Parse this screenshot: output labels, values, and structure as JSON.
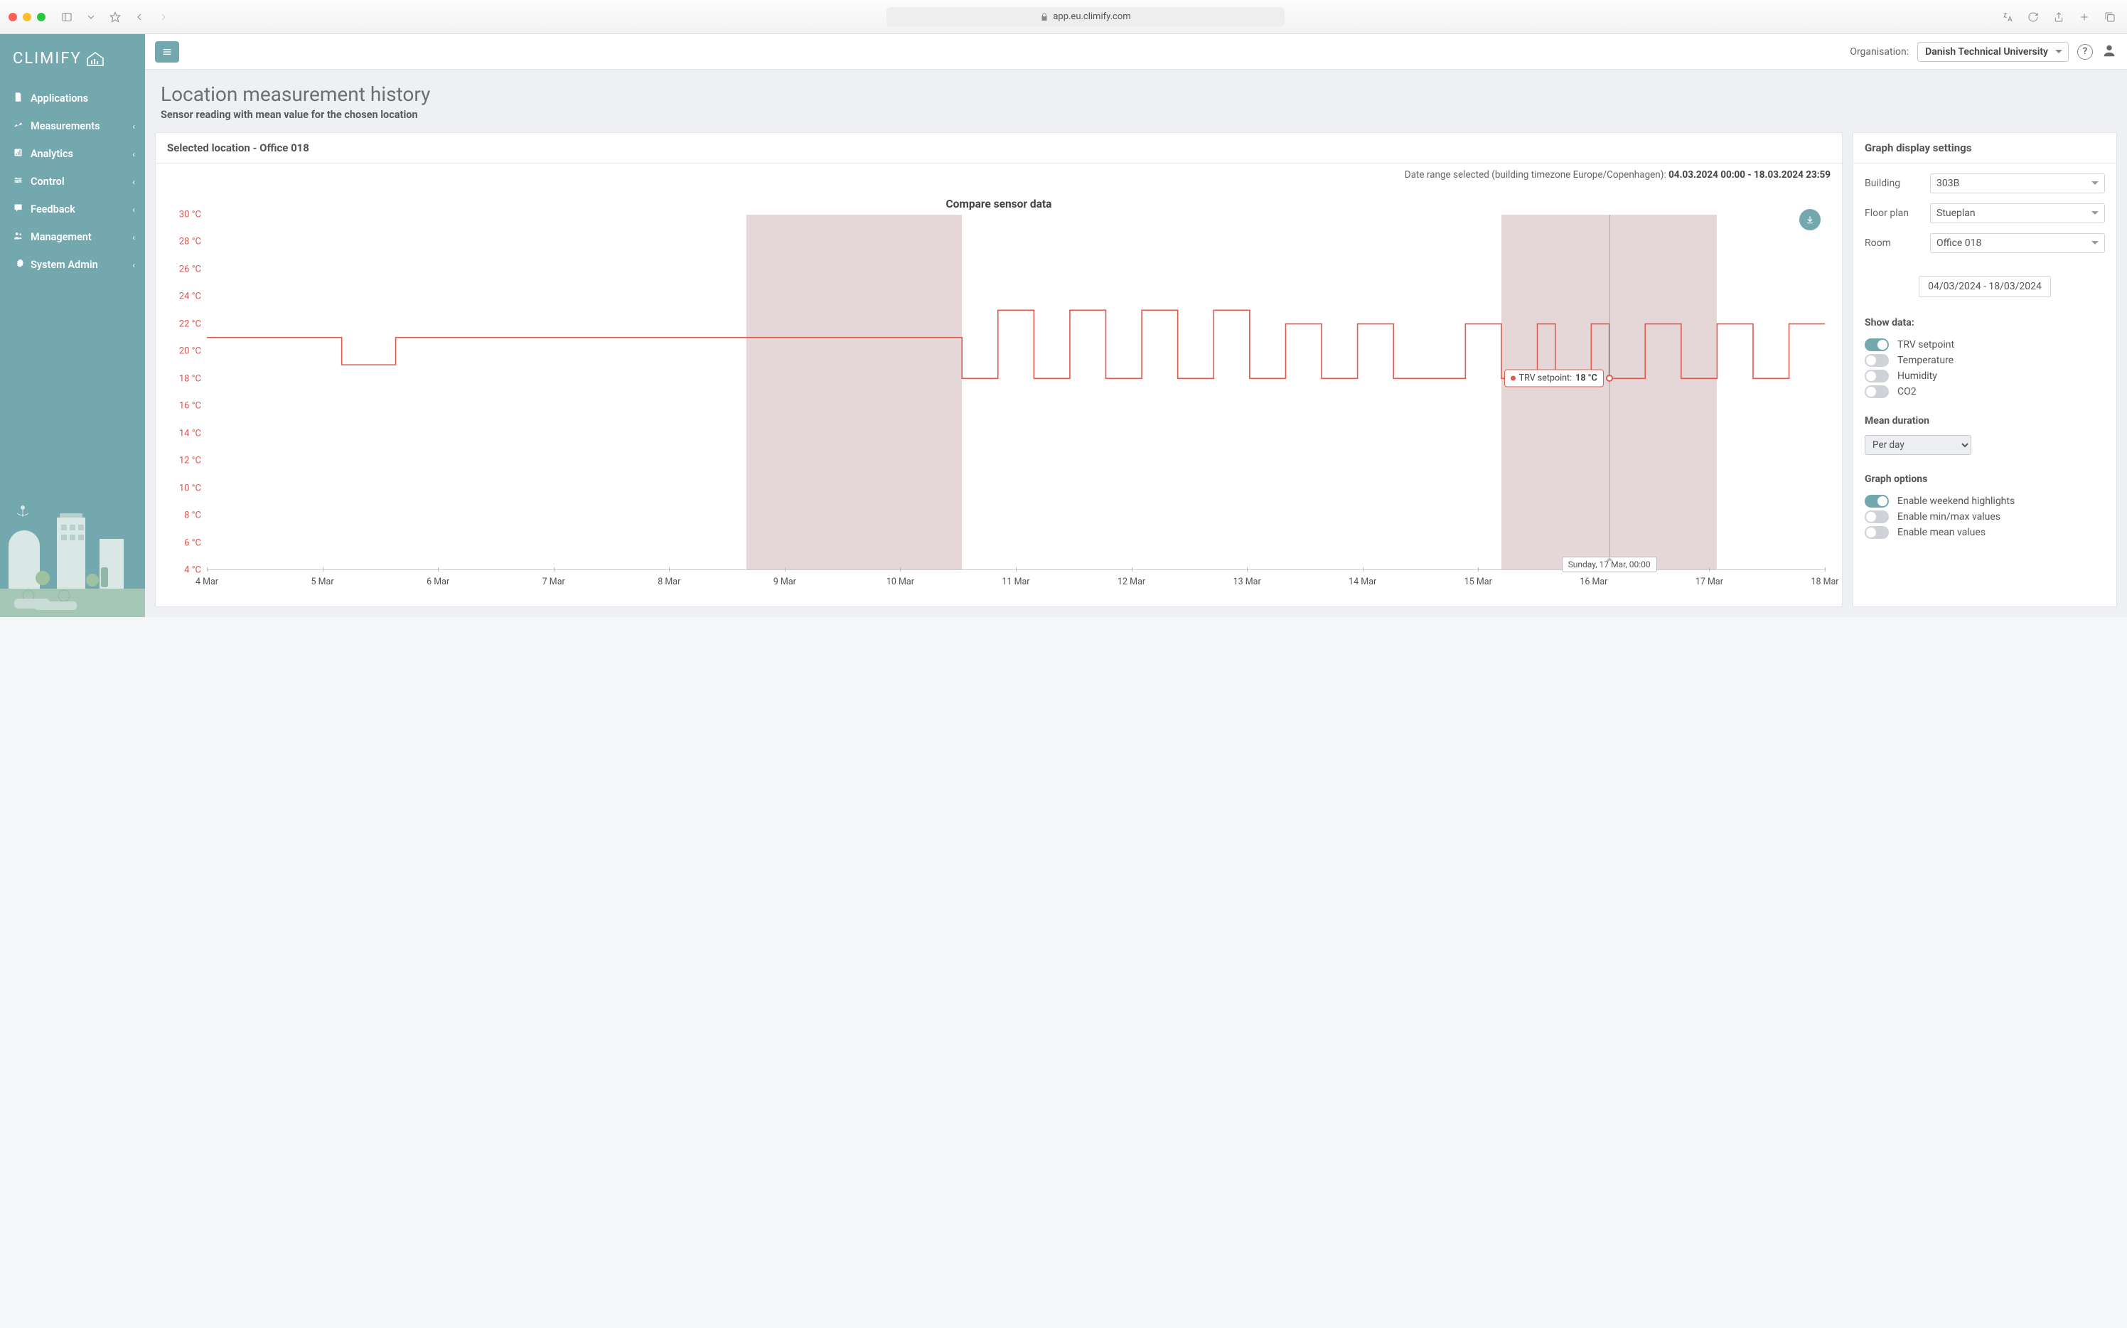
{
  "browser": {
    "url": "app.eu.climify.com"
  },
  "brand": "CLIMIFY",
  "sidebar": {
    "items": [
      {
        "label": "Applications",
        "expandable": false
      },
      {
        "label": "Measurements",
        "expandable": true
      },
      {
        "label": "Analytics",
        "expandable": true
      },
      {
        "label": "Control",
        "expandable": true
      },
      {
        "label": "Feedback",
        "expandable": true
      },
      {
        "label": "Management",
        "expandable": true
      },
      {
        "label": "System Admin",
        "expandable": true
      }
    ]
  },
  "topbar": {
    "org_label": "Organisation:",
    "org_value": "Danish Technical University"
  },
  "page": {
    "title": "Location measurement history",
    "subtitle": "Sensor reading with mean value for the chosen location"
  },
  "left_panel": {
    "header": "Selected location - Office 018",
    "date_range_prefix": "Date range selected (building timezone Europe/Copenhagen): ",
    "date_range_value": "04.03.2024 00:00 - 18.03.2024 23:59",
    "chart_title": "Compare sensor data",
    "tooltip_series": "TRV setpoint:",
    "tooltip_value": "18 °C",
    "x_tooltip": "Sunday, 17 Mar, 00:00"
  },
  "right_panel": {
    "header": "Graph display settings",
    "building_label": "Building",
    "building_value": "303B",
    "floor_label": "Floor plan",
    "floor_value": "Stueplan",
    "room_label": "Room",
    "room_value": "Office 018",
    "date_range": "04/03/2024 - 18/03/2024",
    "show_data_label": "Show data:",
    "toggles": [
      {
        "label": "TRV setpoint",
        "on": true
      },
      {
        "label": "Temperature",
        "on": false
      },
      {
        "label": "Humidity",
        "on": false
      },
      {
        "label": "CO2",
        "on": false
      }
    ],
    "mean_duration_label": "Mean duration",
    "mean_duration_value": "Per day",
    "graph_options_label": "Graph options",
    "options": [
      {
        "label": "Enable weekend highlights",
        "on": true
      },
      {
        "label": "Enable min/max values",
        "on": false
      },
      {
        "label": "Enable mean values",
        "on": false
      }
    ]
  },
  "chart_data": {
    "type": "line",
    "title": "Compare sensor data",
    "ylabel": "°C",
    "ylim": [
      4,
      30
    ],
    "y_ticks": [
      4,
      6,
      8,
      10,
      12,
      14,
      16,
      18,
      20,
      22,
      24,
      26,
      28,
      30
    ],
    "x_categories": [
      "4 Mar",
      "5 Mar",
      "6 Mar",
      "7 Mar",
      "8 Mar",
      "9 Mar",
      "10 Mar",
      "11 Mar",
      "12 Mar",
      "13 Mar",
      "14 Mar",
      "15 Mar",
      "16 Mar",
      "17 Mar",
      "18 Mar"
    ],
    "weekend_bands": [
      [
        "9 Mar",
        "11 Mar"
      ],
      [
        "16 Mar",
        "18 Mar"
      ]
    ],
    "series": [
      {
        "name": "TRV setpoint",
        "color": "#e05a4e",
        "step": true,
        "points": [
          {
            "x": "4 Mar 00:00",
            "y": 21
          },
          {
            "x": "5 Mar 06:00",
            "y": 21
          },
          {
            "x": "5 Mar 06:00",
            "y": 19
          },
          {
            "x": "5 Mar 18:00",
            "y": 19
          },
          {
            "x": "5 Mar 18:00",
            "y": 21
          },
          {
            "x": "11 Mar 00:00",
            "y": 21
          },
          {
            "x": "11 Mar 00:00",
            "y": 18
          },
          {
            "x": "11 Mar 08:00",
            "y": 18
          },
          {
            "x": "11 Mar 08:00",
            "y": 23
          },
          {
            "x": "11 Mar 16:00",
            "y": 23
          },
          {
            "x": "11 Mar 16:00",
            "y": 18
          },
          {
            "x": "12 Mar 00:00",
            "y": 18
          },
          {
            "x": "12 Mar 00:00",
            "y": 23
          },
          {
            "x": "12 Mar 08:00",
            "y": 23
          },
          {
            "x": "12 Mar 08:00",
            "y": 18
          },
          {
            "x": "12 Mar 16:00",
            "y": 18
          },
          {
            "x": "12 Mar 16:00",
            "y": 23
          },
          {
            "x": "13 Mar 00:00",
            "y": 23
          },
          {
            "x": "13 Mar 00:00",
            "y": 18
          },
          {
            "x": "13 Mar 08:00",
            "y": 18
          },
          {
            "x": "13 Mar 08:00",
            "y": 23
          },
          {
            "x": "13 Mar 16:00",
            "y": 23
          },
          {
            "x": "13 Mar 16:00",
            "y": 18
          },
          {
            "x": "14 Mar 00:00",
            "y": 18
          },
          {
            "x": "14 Mar 00:00",
            "y": 22
          },
          {
            "x": "14 Mar 08:00",
            "y": 22
          },
          {
            "x": "14 Mar 08:00",
            "y": 18
          },
          {
            "x": "14 Mar 16:00",
            "y": 18
          },
          {
            "x": "14 Mar 16:00",
            "y": 22
          },
          {
            "x": "15 Mar 00:00",
            "y": 22
          },
          {
            "x": "15 Mar 00:00",
            "y": 18
          },
          {
            "x": "15 Mar 16:00",
            "y": 18
          },
          {
            "x": "15 Mar 16:00",
            "y": 22
          },
          {
            "x": "16 Mar 00:00",
            "y": 22
          },
          {
            "x": "16 Mar 00:00",
            "y": 18
          },
          {
            "x": "16 Mar 08:00",
            "y": 18
          },
          {
            "x": "16 Mar 08:00",
            "y": 22
          },
          {
            "x": "16 Mar 12:00",
            "y": 22
          },
          {
            "x": "16 Mar 12:00",
            "y": 18
          },
          {
            "x": "16 Mar 20:00",
            "y": 18
          },
          {
            "x": "16 Mar 20:00",
            "y": 22
          },
          {
            "x": "17 Mar 00:00",
            "y": 22
          },
          {
            "x": "17 Mar 00:00",
            "y": 18
          },
          {
            "x": "17 Mar 08:00",
            "y": 18
          },
          {
            "x": "17 Mar 08:00",
            "y": 22
          },
          {
            "x": "17 Mar 16:00",
            "y": 22
          },
          {
            "x": "17 Mar 16:00",
            "y": 18
          },
          {
            "x": "18 Mar 00:00",
            "y": 18
          },
          {
            "x": "18 Mar 00:00",
            "y": 22
          },
          {
            "x": "18 Mar 08:00",
            "y": 22
          },
          {
            "x": "18 Mar 08:00",
            "y": 18
          },
          {
            "x": "18 Mar 16:00",
            "y": 18
          },
          {
            "x": "18 Mar 16:00",
            "y": 22
          },
          {
            "x": "18 Mar 23:59",
            "y": 22
          }
        ]
      }
    ],
    "tooltip": {
      "x": "Sunday, 17 Mar, 00:00",
      "series": "TRV setpoint",
      "value": 18,
      "unit": "°C"
    }
  }
}
